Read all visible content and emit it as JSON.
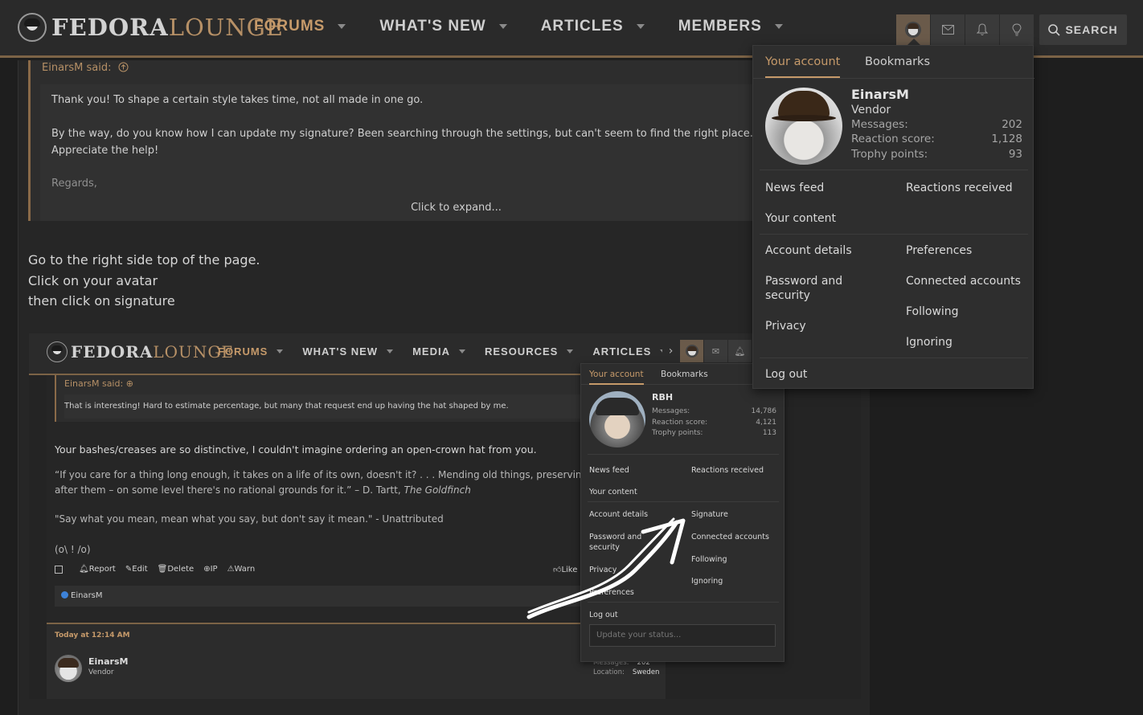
{
  "header": {
    "logo": {
      "part1": "FEDORA",
      "part2": "LOUNGE"
    },
    "nav": [
      {
        "label": "FORUMS"
      },
      {
        "label": "WHAT'S NEW"
      },
      {
        "label": "ARTICLES"
      },
      {
        "label": "MEMBERS"
      }
    ],
    "search_label": "SEARCH",
    "icons": [
      "avatar-icon",
      "mail-icon",
      "bell-icon",
      "lightbulb-icon",
      "search-icon"
    ]
  },
  "quote": {
    "author": "EinarsM said:",
    "line1": "Thank you! To shape a certain style takes time, not all made in one go.",
    "line2": "By the way, do you know how I can update my signature? Been searching through the settings, but can't seem to find the right place.",
    "line3": "Appreciate the help!",
    "line4": "Regards,",
    "expand": "Click to expand..."
  },
  "reply": {
    "line1": "Go to the right side top of the page.",
    "line2": "Click on your avatar",
    "line3": "then click on signature"
  },
  "embedded": {
    "logo": {
      "part1": "FEDORA",
      "part2": "LOUNGE"
    },
    "nav": [
      {
        "label": "FORUMS"
      },
      {
        "label": "WHAT'S NEW"
      },
      {
        "label": "MEDIA"
      },
      {
        "label": "RESOURCES"
      },
      {
        "label": "ARTICLES"
      }
    ],
    "quote_author": "EinarsM said:",
    "quote_text": "That is interesting! Hard to estimate percentage, but many that request end up having the hat shaped by me.",
    "post_text": "Your bashes/creases are so distinctive, I couldn't imagine ordering an open-crown hat from you.",
    "sig1": "“If you care for a thing long enough, it takes on a life of its own, doesn't it? . . . Mending old things, preserving",
    "sig2a": "after them – on some level there's no rational grounds for it.” – D. Tartt, ",
    "sig2b": "The Goldfinch",
    "sig3": "\"Say what you mean, mean what you say, but don't say it mean.\" - Unattributed",
    "sig4": "(o\\ ! /o)",
    "actions": [
      "Report",
      "Edit",
      "Delete",
      "IP",
      "Warn"
    ],
    "like": "Like",
    "reaction_user": "EinarsM",
    "next_time": "Today at 12:14 AM",
    "next_user": "EinarsM",
    "next_role": "Vendor",
    "next_meta": {
      "messages_label": "Messages:",
      "messages": "202",
      "location_label": "Location:",
      "location": "Sweden"
    },
    "popup": {
      "tab_account": "Your account",
      "tab_bookmarks": "Bookmarks",
      "name": "RBH",
      "stats": [
        {
          "label": "Messages:",
          "value": "14,786"
        },
        {
          "label": "Reaction score:",
          "value": "4,121"
        },
        {
          "label": "Trophy points:",
          "value": "113"
        }
      ],
      "links": {
        "news_feed": "News feed",
        "reactions_received": "Reactions received",
        "your_content": "Your content",
        "account_details": "Account details",
        "signature": "Signature",
        "password_security": "Password and security",
        "connected_accounts": "Connected accounts",
        "following": "Following",
        "privacy": "Privacy",
        "ignoring": "Ignoring",
        "preferences": "Preferences",
        "log_out": "Log out"
      },
      "status_placeholder": "Update your status..."
    }
  },
  "account_popup": {
    "tab_account": "Your account",
    "tab_bookmarks": "Bookmarks",
    "name": "EinarsM",
    "role": "Vendor",
    "stats": [
      {
        "label": "Messages:",
        "value": "202"
      },
      {
        "label": "Reaction score:",
        "value": "1,128"
      },
      {
        "label": "Trophy points:",
        "value": "93"
      }
    ],
    "links": {
      "news_feed": "News feed",
      "reactions_received": "Reactions received",
      "your_content": "Your content",
      "account_details": "Account details",
      "preferences": "Preferences",
      "password_security": "Password and security",
      "connected_accounts": "Connected accounts",
      "following": "Following",
      "privacy": "Privacy",
      "ignoring": "Ignoring",
      "log_out": "Log out"
    }
  },
  "colors": {
    "accent": "#c69a6a",
    "header_bg": "#2a2a2a",
    "page_bg": "#1e1e1e"
  }
}
